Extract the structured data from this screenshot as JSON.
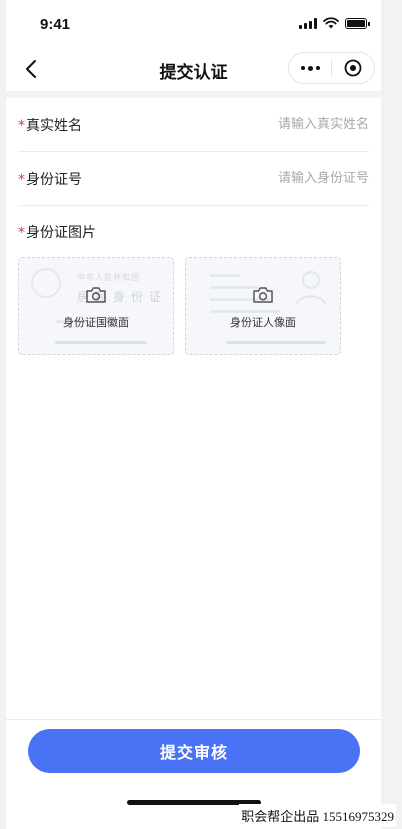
{
  "status_bar": {
    "time": "9:41"
  },
  "nav": {
    "title": "提交认证"
  },
  "form": {
    "name": {
      "required_mark": "*",
      "label": "真实姓名",
      "placeholder": "请输入真实姓名",
      "value": ""
    },
    "id_number": {
      "required_mark": "*",
      "label": "身份证号",
      "placeholder": "请输入身份证号",
      "value": ""
    },
    "photos": {
      "required_mark": "*",
      "label": "身份证图片",
      "front": {
        "caption": "身份证国徽面",
        "heading_small": "中华人民共和国",
        "heading_big": "居民身份证"
      },
      "back": {
        "caption": "身份证人像面"
      }
    }
  },
  "submit_label": "提交审核",
  "footer_credit": "职会帮企出品 15516975329",
  "colors": {
    "accent": "#4a72f4",
    "required": "#e03a3a",
    "placeholder": "#a8a8a8"
  },
  "icons": [
    "back-chevron-icon",
    "more-dots-icon",
    "target-circle-icon",
    "camera-icon",
    "national-emblem-icon",
    "portrait-icon"
  ]
}
